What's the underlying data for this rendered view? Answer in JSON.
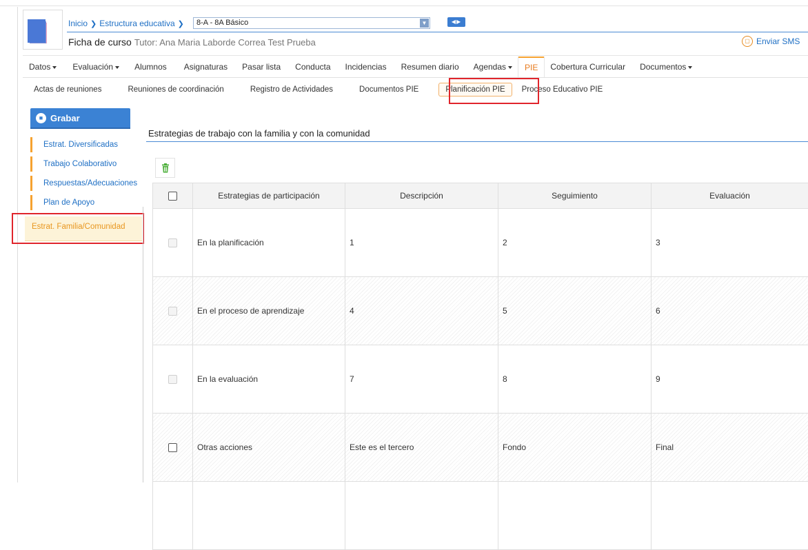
{
  "breadcrumb": {
    "home": "Inicio",
    "structure": "Estructura educativa",
    "course_value": "8-A - 8A Básico"
  },
  "header": {
    "title": "Ficha de curso",
    "tutor": "Tutor: Ana Maria Laborde Correa Test Prueba",
    "sms_label": "Enviar SMS"
  },
  "main_tabs": [
    {
      "label": "Datos",
      "dropdown": true
    },
    {
      "label": "Evaluación",
      "dropdown": true
    },
    {
      "label": "Alumnos"
    },
    {
      "label": "Asignaturas"
    },
    {
      "label": "Pasar lista"
    },
    {
      "label": "Conducta"
    },
    {
      "label": "Incidencias"
    },
    {
      "label": "Resumen diario"
    },
    {
      "label": "Agendas",
      "dropdown": true
    },
    {
      "label": "PIE",
      "active": true
    },
    {
      "label": "Cobertura Curricular"
    },
    {
      "label": "Documentos",
      "dropdown": true
    }
  ],
  "sub_tabs": [
    {
      "label": "Actas de reuniones"
    },
    {
      "label": "Reuniones de coordinación"
    },
    {
      "label": "Registro de Actividades"
    },
    {
      "label": "Documentos PIE"
    },
    {
      "label": "Planificación PIE",
      "active": true
    },
    {
      "label": "Proceso Educativo PIE"
    }
  ],
  "sidebar": {
    "save_label": "Grabar",
    "items": [
      {
        "label": "Estrat. Diversificadas"
      },
      {
        "label": "Trabajo Colaborativo"
      },
      {
        "label": "Respuestas/Adecuaciones"
      },
      {
        "label": "Plan de Apoyo"
      },
      {
        "label": "Estrat. Familia/Comunidad",
        "active": true
      }
    ]
  },
  "section": {
    "title": "Estrategias de trabajo con la familia y con la comunidad"
  },
  "table": {
    "headers": [
      "Estrategias de participación",
      "Descripción",
      "Seguimiento",
      "Evaluación"
    ],
    "rows": [
      {
        "strategy": "En la planificación",
        "description": "1",
        "tracking": "2",
        "evaluation": "3",
        "checkbox_enabled": false
      },
      {
        "strategy": "En el proceso de aprendizaje",
        "description": "4",
        "tracking": "5",
        "evaluation": "6",
        "checkbox_enabled": false
      },
      {
        "strategy": "En la evaluación",
        "description": "7",
        "tracking": "8",
        "evaluation": "9",
        "checkbox_enabled": false
      },
      {
        "strategy": "Otras acciones",
        "description": "Este es el tercero",
        "tracking": "Fondo",
        "evaluation": "Final",
        "checkbox_enabled": true
      }
    ]
  },
  "colors": {
    "accent_blue": "#3b82d4",
    "link_blue": "#1e6fc4",
    "active_orange": "#e87b1e",
    "highlight_red": "#e0242b"
  }
}
